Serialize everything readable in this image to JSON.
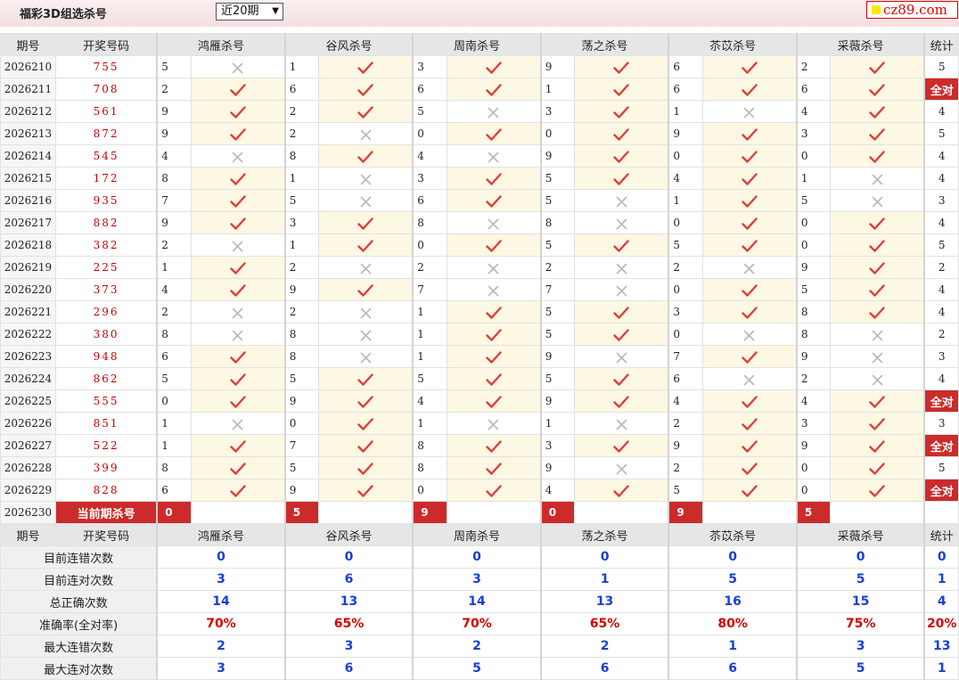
{
  "header": {
    "title": "福彩3D组选杀号",
    "period_select": "近20期",
    "logo_text": "cz89.com"
  },
  "columns": {
    "issue": "期号",
    "draw": "开奖号码",
    "experts": [
      "鸿雁杀号",
      "谷风杀号",
      "周南杀号",
      "荡之杀号",
      "苶苡杀号",
      "采薇杀号"
    ],
    "stat": "统计"
  },
  "icons": {
    "ok": "check-icon",
    "bad": "cross-icon"
  },
  "colors": {
    "check": "#e23c3c",
    "cross": "#b8b8b8",
    "hit_bg": "#fcf8e3",
    "all_right": "#cc2b2b",
    "stat_blue": "#1a3fd6"
  },
  "rows": [
    {
      "issue": "2026210",
      "draw": "755",
      "kills": [
        {
          "n": "5",
          "ok": false
        },
        {
          "n": "1",
          "ok": true
        },
        {
          "n": "3",
          "ok": true
        },
        {
          "n": "9",
          "ok": true
        },
        {
          "n": "6",
          "ok": true
        },
        {
          "n": "2",
          "ok": true
        }
      ],
      "stat": "5",
      "all": false
    },
    {
      "issue": "2026211",
      "draw": "708",
      "kills": [
        {
          "n": "2",
          "ok": true
        },
        {
          "n": "6",
          "ok": true
        },
        {
          "n": "6",
          "ok": true
        },
        {
          "n": "1",
          "ok": true
        },
        {
          "n": "6",
          "ok": true
        },
        {
          "n": "6",
          "ok": true
        }
      ],
      "stat": "全对",
      "all": true
    },
    {
      "issue": "2026212",
      "draw": "561",
      "kills": [
        {
          "n": "9",
          "ok": true
        },
        {
          "n": "2",
          "ok": true
        },
        {
          "n": "5",
          "ok": false
        },
        {
          "n": "3",
          "ok": true
        },
        {
          "n": "1",
          "ok": false
        },
        {
          "n": "4",
          "ok": true
        }
      ],
      "stat": "4",
      "all": false
    },
    {
      "issue": "2026213",
      "draw": "872",
      "kills": [
        {
          "n": "9",
          "ok": true
        },
        {
          "n": "2",
          "ok": false
        },
        {
          "n": "0",
          "ok": true
        },
        {
          "n": "0",
          "ok": true
        },
        {
          "n": "9",
          "ok": true
        },
        {
          "n": "3",
          "ok": true
        }
      ],
      "stat": "5",
      "all": false
    },
    {
      "issue": "2026214",
      "draw": "545",
      "kills": [
        {
          "n": "4",
          "ok": false
        },
        {
          "n": "8",
          "ok": true
        },
        {
          "n": "4",
          "ok": false
        },
        {
          "n": "9",
          "ok": true
        },
        {
          "n": "0",
          "ok": true
        },
        {
          "n": "0",
          "ok": true
        }
      ],
      "stat": "4",
      "all": false
    },
    {
      "issue": "2026215",
      "draw": "172",
      "kills": [
        {
          "n": "8",
          "ok": true
        },
        {
          "n": "1",
          "ok": false
        },
        {
          "n": "3",
          "ok": true
        },
        {
          "n": "5",
          "ok": true
        },
        {
          "n": "4",
          "ok": true
        },
        {
          "n": "1",
          "ok": false
        }
      ],
      "stat": "4",
      "all": false
    },
    {
      "issue": "2026216",
      "draw": "935",
      "kills": [
        {
          "n": "7",
          "ok": true
        },
        {
          "n": "5",
          "ok": false
        },
        {
          "n": "6",
          "ok": true
        },
        {
          "n": "5",
          "ok": false
        },
        {
          "n": "1",
          "ok": true
        },
        {
          "n": "5",
          "ok": false
        }
      ],
      "stat": "3",
      "all": false
    },
    {
      "issue": "2026217",
      "draw": "882",
      "kills": [
        {
          "n": "9",
          "ok": true
        },
        {
          "n": "3",
          "ok": true
        },
        {
          "n": "8",
          "ok": false
        },
        {
          "n": "8",
          "ok": false
        },
        {
          "n": "0",
          "ok": true
        },
        {
          "n": "0",
          "ok": true
        }
      ],
      "stat": "4",
      "all": false
    },
    {
      "issue": "2026218",
      "draw": "382",
      "kills": [
        {
          "n": "2",
          "ok": false
        },
        {
          "n": "1",
          "ok": true
        },
        {
          "n": "0",
          "ok": true
        },
        {
          "n": "5",
          "ok": true
        },
        {
          "n": "5",
          "ok": true
        },
        {
          "n": "0",
          "ok": true
        }
      ],
      "stat": "5",
      "all": false
    },
    {
      "issue": "2026219",
      "draw": "225",
      "kills": [
        {
          "n": "1",
          "ok": true
        },
        {
          "n": "2",
          "ok": false
        },
        {
          "n": "2",
          "ok": false
        },
        {
          "n": "2",
          "ok": false
        },
        {
          "n": "2",
          "ok": false
        },
        {
          "n": "9",
          "ok": true
        }
      ],
      "stat": "2",
      "all": false
    },
    {
      "issue": "2026220",
      "draw": "373",
      "kills": [
        {
          "n": "4",
          "ok": true
        },
        {
          "n": "9",
          "ok": true
        },
        {
          "n": "7",
          "ok": false
        },
        {
          "n": "7",
          "ok": false
        },
        {
          "n": "0",
          "ok": true
        },
        {
          "n": "5",
          "ok": true
        }
      ],
      "stat": "4",
      "all": false
    },
    {
      "issue": "2026221",
      "draw": "296",
      "kills": [
        {
          "n": "2",
          "ok": false
        },
        {
          "n": "2",
          "ok": false
        },
        {
          "n": "1",
          "ok": true
        },
        {
          "n": "5",
          "ok": true
        },
        {
          "n": "3",
          "ok": true
        },
        {
          "n": "8",
          "ok": true
        }
      ],
      "stat": "4",
      "all": false
    },
    {
      "issue": "2026222",
      "draw": "380",
      "kills": [
        {
          "n": "8",
          "ok": false
        },
        {
          "n": "8",
          "ok": false
        },
        {
          "n": "1",
          "ok": true
        },
        {
          "n": "5",
          "ok": true
        },
        {
          "n": "0",
          "ok": false
        },
        {
          "n": "8",
          "ok": false
        }
      ],
      "stat": "2",
      "all": false
    },
    {
      "issue": "2026223",
      "draw": "948",
      "kills": [
        {
          "n": "6",
          "ok": true
        },
        {
          "n": "8",
          "ok": false
        },
        {
          "n": "1",
          "ok": true
        },
        {
          "n": "9",
          "ok": false
        },
        {
          "n": "7",
          "ok": true
        },
        {
          "n": "9",
          "ok": false
        }
      ],
      "stat": "3",
      "all": false
    },
    {
      "issue": "2026224",
      "draw": "862",
      "kills": [
        {
          "n": "5",
          "ok": true
        },
        {
          "n": "5",
          "ok": true
        },
        {
          "n": "5",
          "ok": true
        },
        {
          "n": "5",
          "ok": true
        },
        {
          "n": "6",
          "ok": false
        },
        {
          "n": "2",
          "ok": false
        }
      ],
      "stat": "4",
      "all": false
    },
    {
      "issue": "2026225",
      "draw": "555",
      "kills": [
        {
          "n": "0",
          "ok": true
        },
        {
          "n": "9",
          "ok": true
        },
        {
          "n": "4",
          "ok": true
        },
        {
          "n": "9",
          "ok": true
        },
        {
          "n": "4",
          "ok": true
        },
        {
          "n": "4",
          "ok": true
        }
      ],
      "stat": "全对",
      "all": true
    },
    {
      "issue": "2026226",
      "draw": "851",
      "kills": [
        {
          "n": "1",
          "ok": false
        },
        {
          "n": "0",
          "ok": true
        },
        {
          "n": "1",
          "ok": false
        },
        {
          "n": "1",
          "ok": false
        },
        {
          "n": "2",
          "ok": true
        },
        {
          "n": "3",
          "ok": true
        }
      ],
      "stat": "3",
      "all": false
    },
    {
      "issue": "2026227",
      "draw": "522",
      "kills": [
        {
          "n": "1",
          "ok": true
        },
        {
          "n": "7",
          "ok": true
        },
        {
          "n": "8",
          "ok": true
        },
        {
          "n": "3",
          "ok": true
        },
        {
          "n": "9",
          "ok": true
        },
        {
          "n": "9",
          "ok": true
        }
      ],
      "stat": "全对",
      "all": true
    },
    {
      "issue": "2026228",
      "draw": "399",
      "kills": [
        {
          "n": "8",
          "ok": true
        },
        {
          "n": "5",
          "ok": true
        },
        {
          "n": "8",
          "ok": true
        },
        {
          "n": "9",
          "ok": false
        },
        {
          "n": "2",
          "ok": true
        },
        {
          "n": "0",
          "ok": true
        }
      ],
      "stat": "5",
      "all": false
    },
    {
      "issue": "2026229",
      "draw": "828",
      "kills": [
        {
          "n": "6",
          "ok": true
        },
        {
          "n": "9",
          "ok": true
        },
        {
          "n": "0",
          "ok": true
        },
        {
          "n": "4",
          "ok": true
        },
        {
          "n": "5",
          "ok": true
        },
        {
          "n": "0",
          "ok": true
        }
      ],
      "stat": "全对",
      "all": true
    }
  ],
  "current": {
    "issue": "2026230",
    "label": "当前期杀号",
    "kills": [
      "0",
      "5",
      "9",
      "0",
      "9",
      "5"
    ]
  },
  "summary": [
    {
      "label": "目前连错次数",
      "values": [
        "0",
        "0",
        "0",
        "0",
        "0",
        "0",
        "0"
      ],
      "red": false
    },
    {
      "label": "目前连对次数",
      "values": [
        "3",
        "6",
        "3",
        "1",
        "5",
        "5",
        "1"
      ],
      "red": false
    },
    {
      "label": "总正确次数",
      "values": [
        "14",
        "13",
        "14",
        "13",
        "16",
        "15",
        "4"
      ],
      "red": false
    },
    {
      "label": "准确率(全对率)",
      "values": [
        "70%",
        "65%",
        "70%",
        "65%",
        "80%",
        "75%",
        "20%"
      ],
      "red": true
    },
    {
      "label": "最大连错次数",
      "values": [
        "2",
        "3",
        "2",
        "2",
        "1",
        "3",
        "13"
      ],
      "red": false
    },
    {
      "label": "最大连对次数",
      "values": [
        "3",
        "6",
        "5",
        "6",
        "6",
        "5",
        "1"
      ],
      "red": false
    }
  ]
}
